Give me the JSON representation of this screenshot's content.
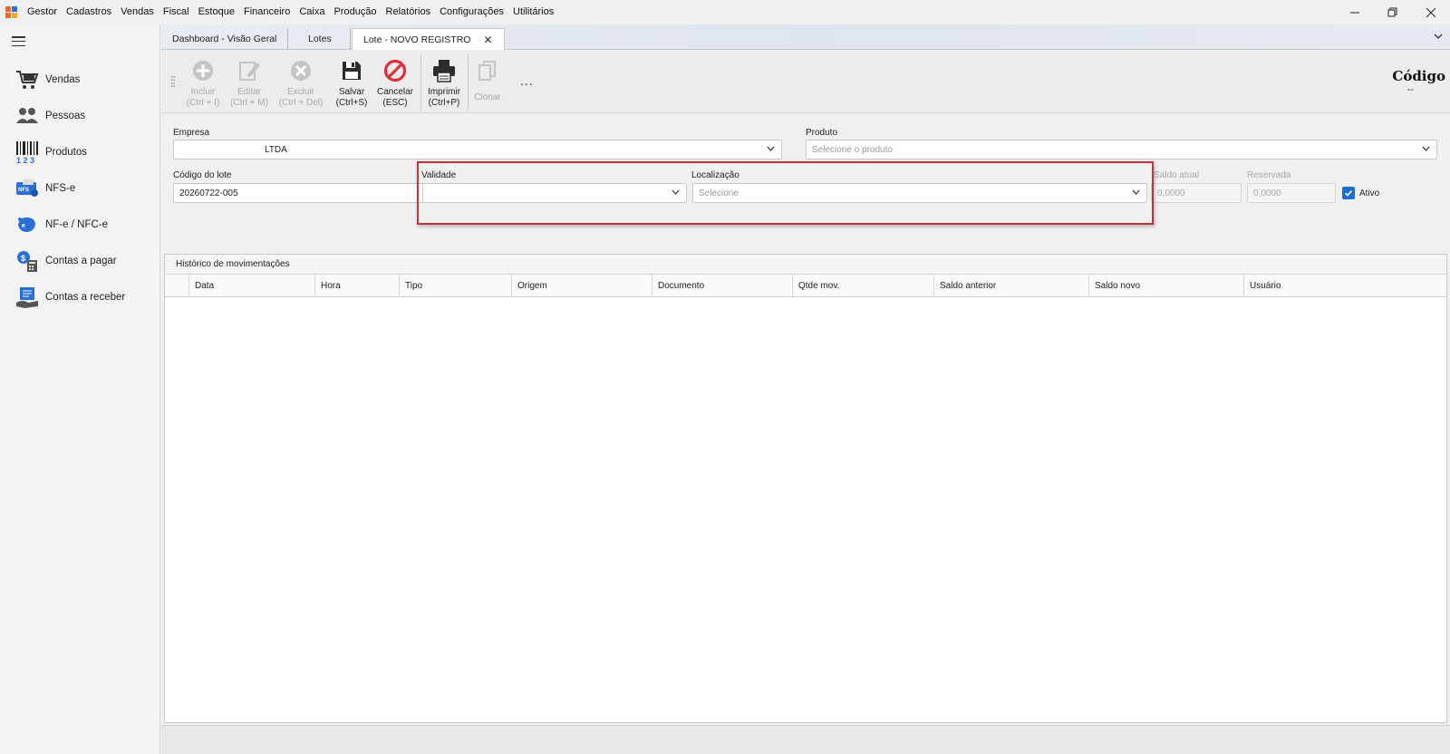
{
  "menu": {
    "items": [
      "Gestor",
      "Cadastros",
      "Vendas",
      "Fiscal",
      "Estoque",
      "Financeiro",
      "Caixa",
      "Produção",
      "Relatórios",
      "Configurações",
      "Utilitários"
    ]
  },
  "window": {
    "minimize_glyph": "—",
    "maximize_glyph": "❐",
    "close_glyph": "✕"
  },
  "sidebar": {
    "items": [
      {
        "label": "Vendas",
        "icon": "cart-icon"
      },
      {
        "label": "Pessoas",
        "icon": "people-icon"
      },
      {
        "label": "Produtos",
        "icon": "barcode-icon"
      },
      {
        "label": "NFS-e",
        "icon": "nfse-icon"
      },
      {
        "label": "NF-e / NFC-e",
        "icon": "nfe-icon"
      },
      {
        "label": "Contas a pagar",
        "icon": "bills-payable-icon"
      },
      {
        "label": "Contas a receber",
        "icon": "bills-receivable-icon"
      }
    ]
  },
  "tabs": [
    {
      "label": "Dashboard - Visão Geral"
    },
    {
      "label": "Lotes"
    },
    {
      "label": "Lote - NOVO REGISTRO",
      "active": true
    }
  ],
  "toolbar": {
    "incluir": {
      "line1": "Incluir",
      "line2": "(Ctrl + I)"
    },
    "editar": {
      "line1": "Editar",
      "line2": "(Ctrl + M)"
    },
    "excluir": {
      "line1": "Excluir",
      "line2": "(Ctrl + Del)"
    },
    "salvar": {
      "line1": "Salvar",
      "line2": "(Ctrl+S)"
    },
    "cancelar": {
      "line1": "Cancelar",
      "line2": "(ESC)"
    },
    "imprimir": {
      "line1": "Imprimir",
      "line2": "(Ctrl+P)"
    },
    "clonar": {
      "line1": "Clonar"
    },
    "more": "..."
  },
  "header": {
    "codigo_label": "Código",
    "codigo_value": "--"
  },
  "form": {
    "empresa": {
      "label": "Empresa",
      "value": "LTDA"
    },
    "produto": {
      "label": "Produto",
      "placeholder": "Selecione o produto"
    },
    "codigo_lote": {
      "label": "Código do lote",
      "value": "20260722-005"
    },
    "validade": {
      "label": "Validade",
      "value": ""
    },
    "localizacao": {
      "label": "Localização",
      "placeholder": "Selecione"
    },
    "saldo_atual": {
      "label": "Saldo atual",
      "value": "0,0000"
    },
    "reservada": {
      "label": "Reservada",
      "value": "0,0000"
    },
    "ativo": {
      "label": "Ativo",
      "checked": true
    }
  },
  "history": {
    "title": "Histórico de movimentações",
    "columns": [
      "Data",
      "Hora",
      "Tipo",
      "Origem",
      "Documento",
      "Qtde mov.",
      "Saldo anterior",
      "Saldo novo",
      "Usuário"
    ]
  },
  "colors": {
    "accent_blue": "#1f6fd1",
    "highlight_red": "#c0333a",
    "cancel_red": "#e0303c"
  }
}
